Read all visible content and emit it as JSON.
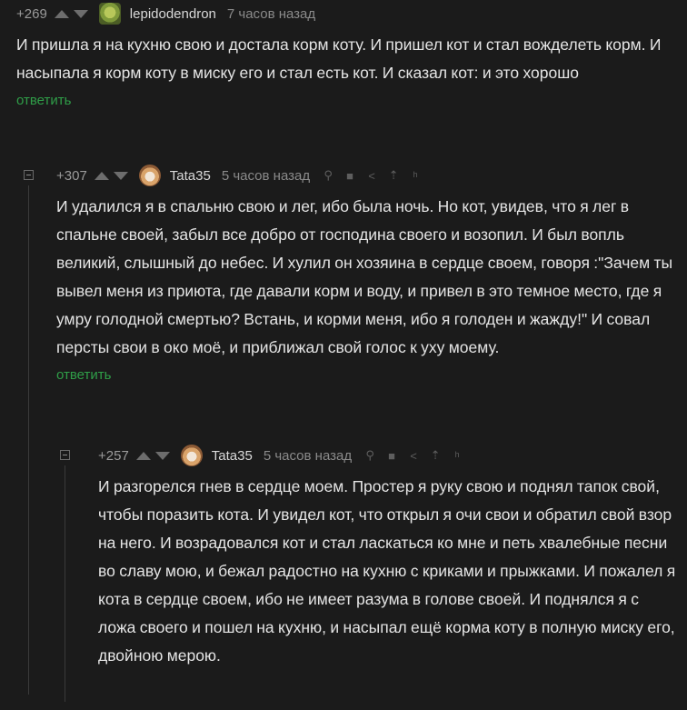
{
  "comments": [
    {
      "rating": "+269",
      "username": "lepidodendron",
      "time": "7 часов назад",
      "text": "И пришла я на кухню свою и достала корм коту. И пришел кот и стал вожделеть корм. И насыпала я корм коту в миску его и стал есть кот. И сказал кот: и это хорошо",
      "reply_label": "ответить"
    },
    {
      "rating": "+307",
      "username": "Tata35",
      "time": "5 часов назад",
      "text": "И удалился я в спальню свою и лег, ибо была ночь. Но кот, увидев, что я лег в спальне своей, забыл все добро от господина своего и возопил. И был вопль великий, слышный до небес. И хулил он хозяина в сердце своем, говоря :\"Зачем ты вывел меня из приюта, где давали корм и воду, и привел в это темное место, где я умру голодной смертью? Встань, и корми меня, ибо я голоден и жажду!\"  И совал персты свои в око моё, и приближал свой голос к уху моему.",
      "reply_label": "ответить"
    },
    {
      "rating": "+257",
      "username": "Tata35",
      "time": "5 часов назад",
      "text": "И разгорелся гнев в сердце моем. Простер я руку свою и поднял тапок свой, чтобы поразить кота. И увидел кот, что открыл я очи свои и обратил свой взор на него. И возрадовался кот и стал ласкаться ко мне и петь хвалебные песни во славу мою, и бежал радостно на кухню с криками и прыжками. И пожалел я кота в сердце своем, ибо не имеет разума в голове своей. И поднялся я с ложа своего и пошел на кухню, и насыпал ещё корма коту в полную миску его, двойною мерою."
    }
  ],
  "icons": [
    "vote-up-icon",
    "vote-down-icon",
    "link-icon",
    "save-icon",
    "share-icon",
    "branch-up-icon",
    "branch-icon",
    "collapse-icon"
  ]
}
